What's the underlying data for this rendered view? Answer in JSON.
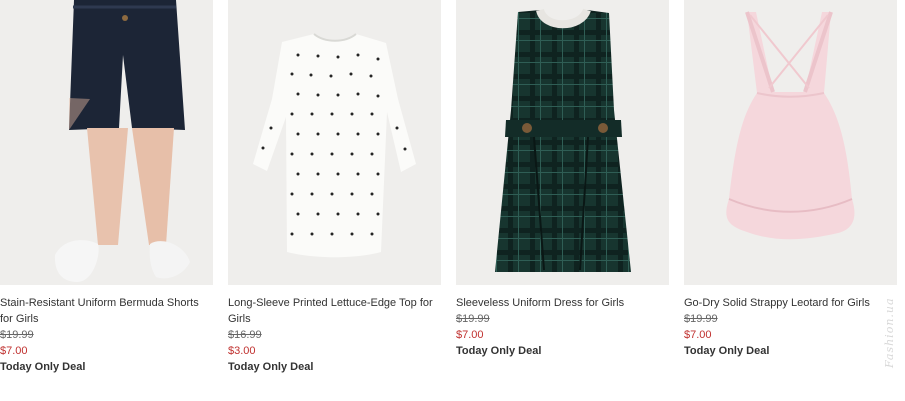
{
  "products": [
    {
      "name": "Stain-Resistant Uniform Bermuda Shorts for Girls",
      "was_price": "$19.99",
      "now_price": "$7.00",
      "deal": "Today Only Deal",
      "image_label": "navy bermuda shorts"
    },
    {
      "name": "Long-Sleeve Printed Lettuce-Edge Top for Girls",
      "was_price": "$16.99",
      "now_price": "$3.00",
      "deal": "Today Only Deal",
      "image_label": "white polka dot top"
    },
    {
      "name": "Sleeveless Uniform Dress for Girls",
      "was_price": "$19.99",
      "now_price": "$7.00",
      "deal": "Today Only Deal",
      "image_label": "plaid uniform dress"
    },
    {
      "name": "Go-Dry Solid Strappy Leotard for Girls",
      "was_price": "$19.99",
      "now_price": "$7.00",
      "deal": "Today Only Deal",
      "image_label": "pink leotard"
    }
  ],
  "watermark": "Fashion.ua"
}
